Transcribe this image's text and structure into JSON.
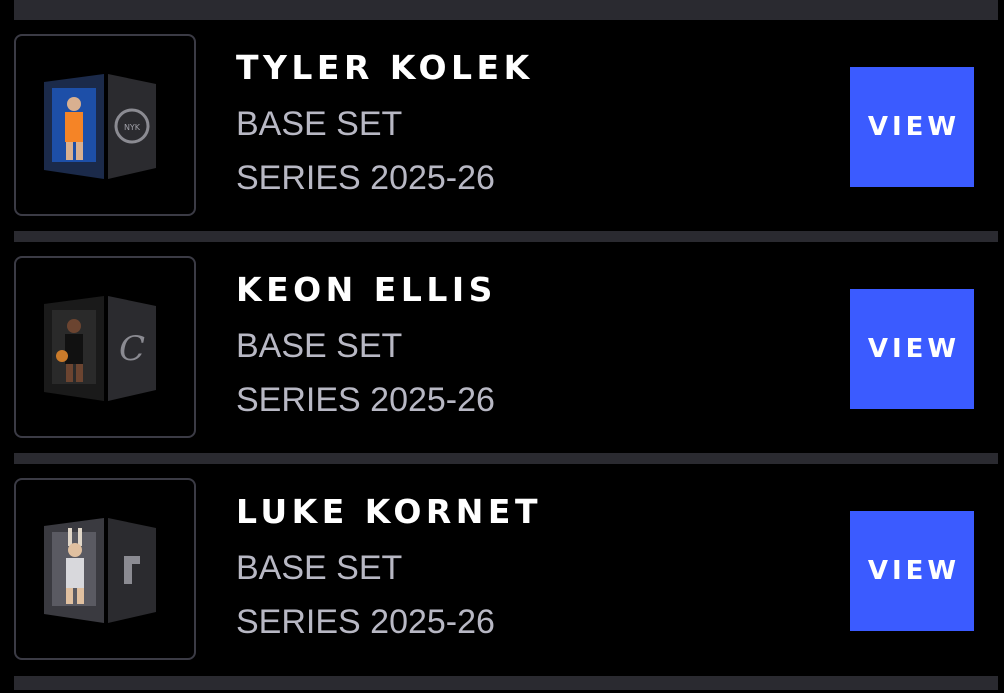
{
  "cards": [
    {
      "player": "TYLER KOLEK",
      "set": "BASE SET",
      "series": "SERIES 2025-26",
      "action_label": "VIEW",
      "team_logo_icon": "knicks-logo-icon",
      "jersey_color": "#1d4fa8",
      "accent_color": "#f58426"
    },
    {
      "player": "KEON ELLIS",
      "set": "BASE SET",
      "series": "SERIES 2025-26",
      "action_label": "VIEW",
      "team_logo_icon": "cavaliers-logo-icon",
      "jersey_color": "#2a2a2a",
      "accent_color": "#c9a227"
    },
    {
      "player": "LUKE KORNET",
      "set": "BASE SET",
      "series": "SERIES 2025-26",
      "action_label": "VIEW",
      "team_logo_icon": "spurs-logo-icon",
      "jersey_color": "#cfcfd4",
      "accent_color": "#8a8a8a"
    }
  ],
  "colors": {
    "background": "#000000",
    "separator": "#2a2a30",
    "button": "#3b5bff",
    "title_text": "#ffffff",
    "subtitle_text": "#b8b8c4",
    "thumb_border": "#3b3b45"
  }
}
